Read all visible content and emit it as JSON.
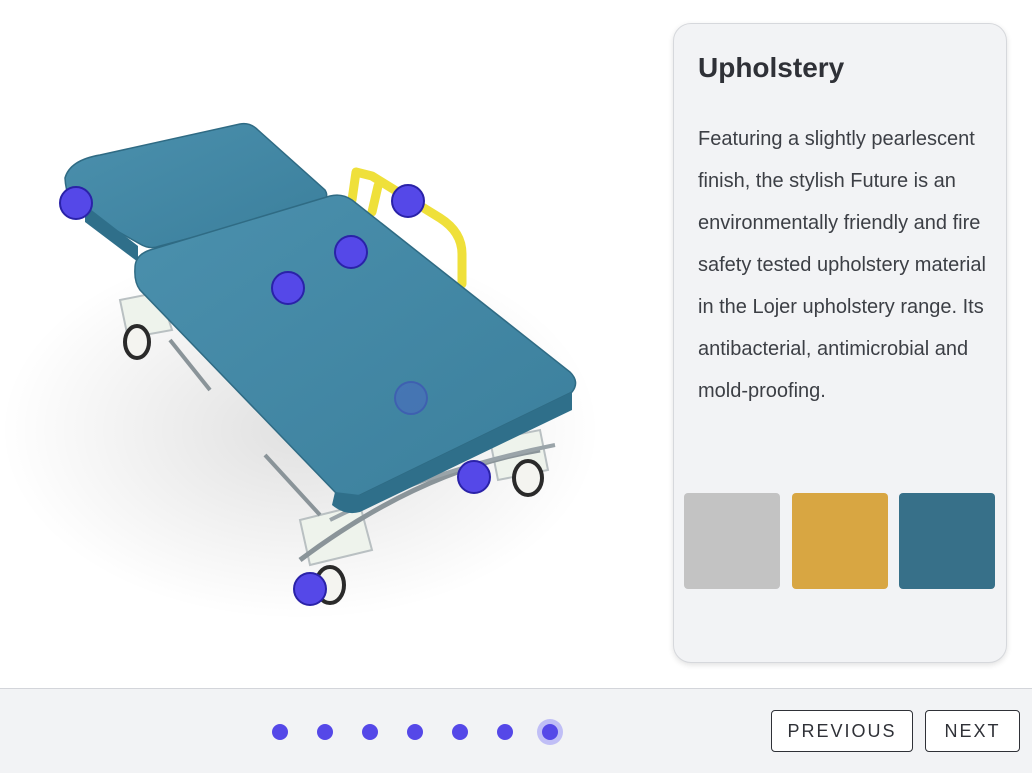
{
  "panel": {
    "title": "Upholstery",
    "description": "Featuring a slightly pearlescent finish, the stylish Future is an environmentally friendly and fire safety tested upholstery material in the Lojer upholstery range. Its antibacterial, antimicrobial and mold-proofing.",
    "swatches": [
      {
        "name": "grey-swatch",
        "color": "#c3c3c3"
      },
      {
        "name": "gold-swatch",
        "color": "#d8a642"
      },
      {
        "name": "teal-swatch",
        "color": "#377089"
      }
    ]
  },
  "colors": {
    "upholstery": "#3f86a3",
    "hotspot": "#5548e8",
    "rail": "#f2e03a"
  },
  "pagination": {
    "total": 7,
    "active_index": 6
  },
  "nav": {
    "previous_label": "PREVIOUS",
    "next_label": "NEXT"
  }
}
